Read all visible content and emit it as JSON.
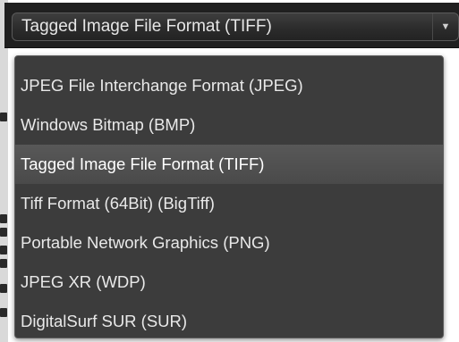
{
  "format_select": {
    "selected_label": "Tagged Image File Format (TIFF)",
    "arrow_icon": "chevron-down-icon"
  },
  "dropdown": {
    "options": [
      {
        "label": "JPEG File Interchange Format (JPEG)",
        "selected": false
      },
      {
        "label": "Windows Bitmap (BMP)",
        "selected": false
      },
      {
        "label": "Tagged Image File Format (TIFF)",
        "selected": true
      },
      {
        "label": "Tiff Format (64Bit) (BigTiff)",
        "selected": false
      },
      {
        "label": "Portable Network Graphics (PNG)",
        "selected": false
      },
      {
        "label": "JPEG XR (WDP)",
        "selected": false
      },
      {
        "label": "DigitalSurf SUR (SUR)",
        "selected": false
      }
    ]
  },
  "colors": {
    "panel_bg": "#202020",
    "list_bg": "#3c3c3c",
    "selected_bg": "#505050",
    "text": "#e9e9e9"
  }
}
